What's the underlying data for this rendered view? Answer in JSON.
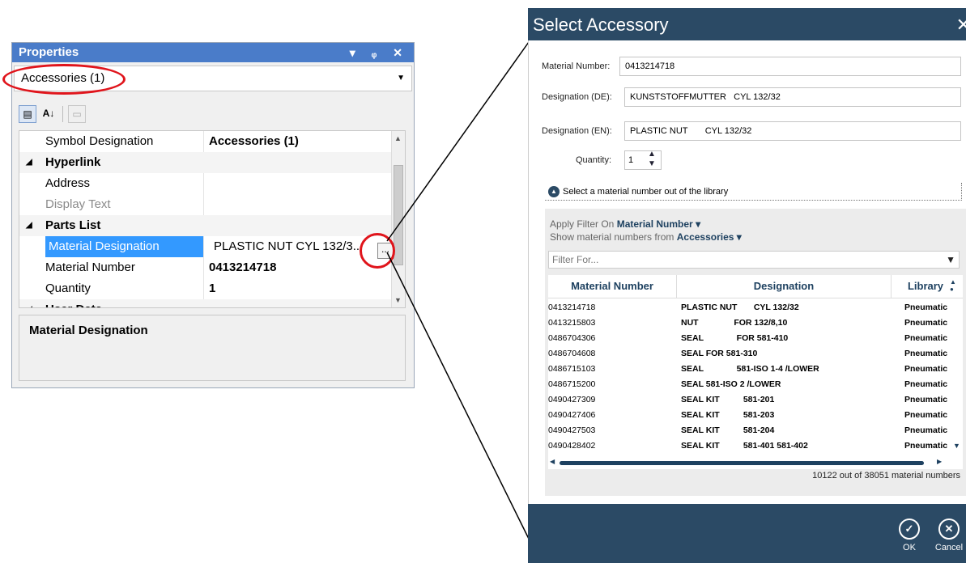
{
  "properties": {
    "title": "Properties",
    "title_controls": "▾ ᵩ ✕",
    "combo_value": "Accessories (1)",
    "rows": [
      {
        "key": "Symbol Designation",
        "value": "Accessories (1)"
      },
      {
        "category": "Hyperlink"
      },
      {
        "key": "Address",
        "value": ""
      },
      {
        "key": "Display Text",
        "value": ""
      },
      {
        "category": "Parts List"
      },
      {
        "key": "Material Designation",
        "value": "PLASTIC NUT        CYL 132/3..."
      },
      {
        "key": "Material Number",
        "value": "0413214718"
      },
      {
        "key": "Quantity",
        "value": "1"
      },
      {
        "category": "User Data"
      }
    ],
    "description_title": "Material Designation",
    "ellipsis_label": "..."
  },
  "dialog": {
    "title": "Select Accessory",
    "close_label": "✕",
    "fields": {
      "material_number_label": "Material Number:",
      "material_number_value": "0413214718",
      "designation_de_label": "Designation (DE):",
      "designation_de_value": "KUNSTSTOFFMUTTER   CYL 132/32",
      "designation_en_label": "Designation (EN):",
      "designation_en_value": "PLASTIC NUT       CYL 132/32",
      "quantity_label": "Quantity:",
      "quantity_value": "1"
    },
    "library_toggle_label": "Select a material number out of the library",
    "library": {
      "apply_filter_prefix": "Apply Filter On",
      "apply_filter_value": "Material Number ▾",
      "show_prefix": "Show material numbers from",
      "show_value": "Accessories ▾",
      "filter_placeholder": "Filter For...",
      "columns": [
        "Material Number",
        "Designation",
        "Library"
      ],
      "rows": [
        {
          "number": "0413214718",
          "designation": "PLASTIC NUT       CYL 132/32",
          "library": "Pneumatic"
        },
        {
          "number": "0413215803",
          "designation": "NUT               FOR 132/8,10",
          "library": "Pneumatic"
        },
        {
          "number": "0486704306",
          "designation": "SEAL              FOR 581-410",
          "library": "Pneumatic"
        },
        {
          "number": "0486704608",
          "designation": "SEAL FOR 581-310",
          "library": "Pneumatic"
        },
        {
          "number": "0486715103",
          "designation": "SEAL              581-ISO 1-4 /LOWER",
          "library": "Pneumatic"
        },
        {
          "number": "0486715200",
          "designation": "SEAL 581-ISO 2 /LOWER",
          "library": "Pneumatic"
        },
        {
          "number": "0490427309",
          "designation": "SEAL KIT          581-201",
          "library": "Pneumatic"
        },
        {
          "number": "0490427406",
          "designation": "SEAL KIT          581-203",
          "library": "Pneumatic"
        },
        {
          "number": "0490427503",
          "designation": "SEAL KIT          581-204",
          "library": "Pneumatic"
        },
        {
          "number": "0490428402",
          "designation": "SEAL KIT          581-401 581-402",
          "library": "Pneumatic"
        }
      ],
      "status": "10122 out of 38051 material numbers"
    },
    "ok_label": "OK",
    "cancel_label": "Cancel"
  },
  "colors": {
    "dialog_header": "#2b4a65",
    "properties_title": "#4a7cc9",
    "selection": "#3399ff",
    "highlight_oval": "#e0141b"
  }
}
